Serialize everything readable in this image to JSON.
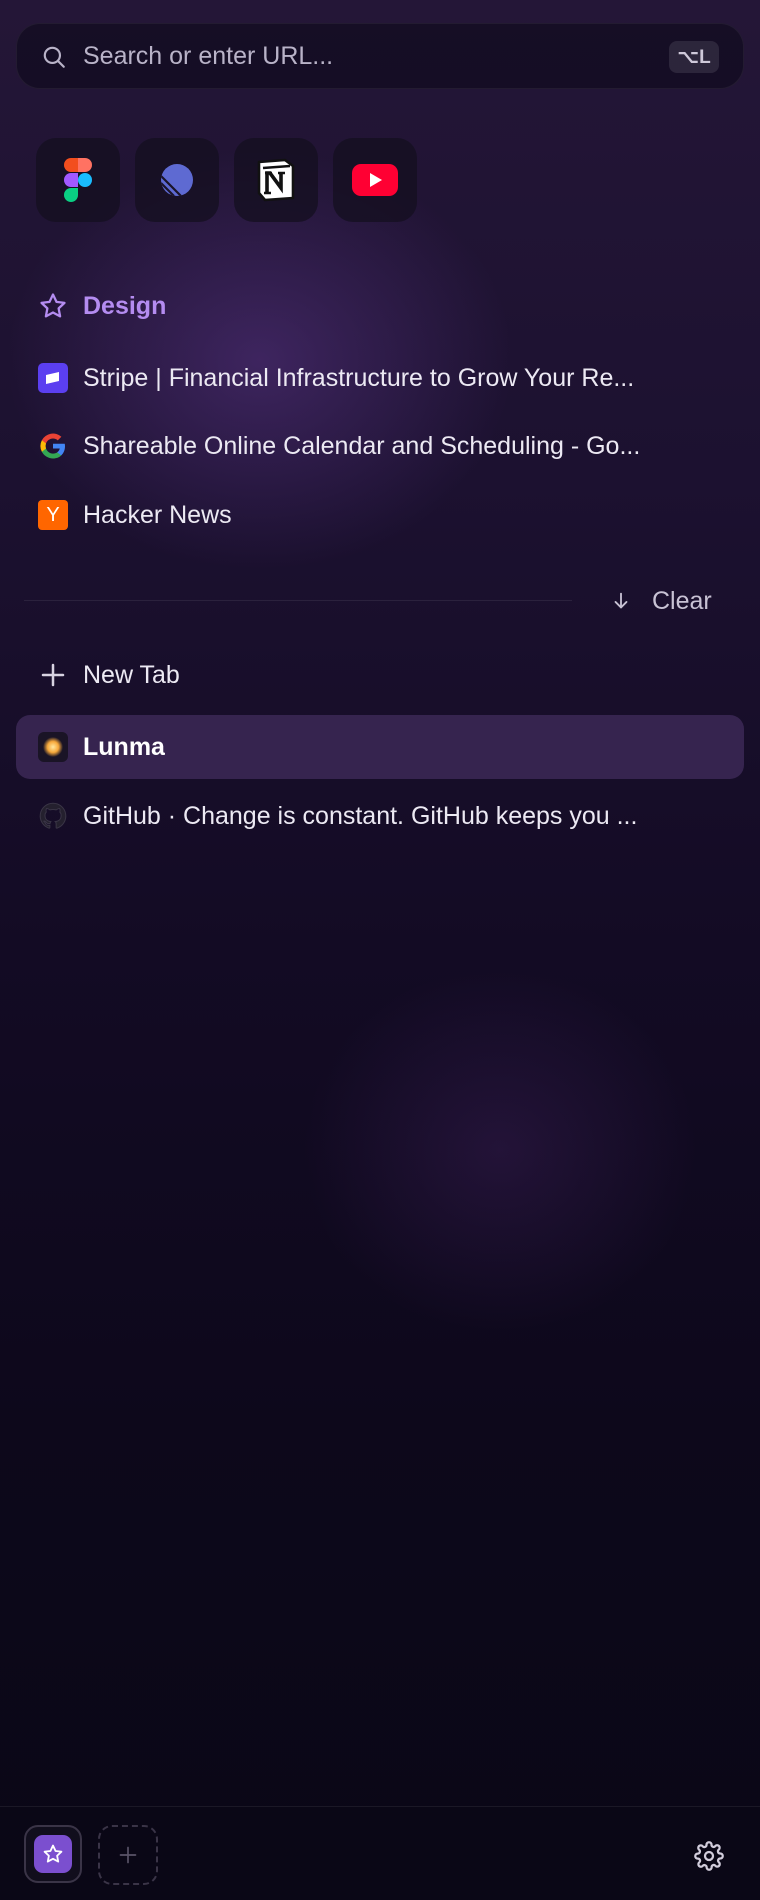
{
  "search": {
    "placeholder": "Search or enter URL...",
    "shortcut": "⌥L"
  },
  "pinned": [
    {
      "name": "Figma",
      "icon": "figma-icon"
    },
    {
      "name": "Linear",
      "icon": "linear-icon"
    },
    {
      "name": "Notion",
      "icon": "notion-icon"
    },
    {
      "name": "YouTube",
      "icon": "youtube-icon"
    }
  ],
  "folder": {
    "label": "Design",
    "icon": "star-icon",
    "items": [
      {
        "label": "Stripe | Financial Infrastructure to Grow Your Re...",
        "icon": "stripe-icon"
      },
      {
        "label": "Shareable Online Calendar and Scheduling - Go...",
        "icon": "google-icon"
      },
      {
        "label": "Hacker News",
        "icon": "hacker-news-icon",
        "glyph": "Y"
      }
    ]
  },
  "clear": {
    "label": "Clear",
    "icon": "arrow-down-icon"
  },
  "tabs": {
    "new_tab_label": "New Tab",
    "items": [
      {
        "label": "Lunma",
        "icon": "lunma-icon",
        "active": true
      },
      {
        "label": "GitHub · Change is constant. GitHub keeps you ...",
        "icon": "github-icon",
        "active": false
      }
    ]
  },
  "footer": {
    "space_icon": "star-icon",
    "add_icon": "plus-icon",
    "settings_icon": "gear-icon"
  },
  "colors": {
    "accent": "#b48cf0",
    "active_row": "#36244f",
    "space_badge": "#7b4fcf"
  }
}
